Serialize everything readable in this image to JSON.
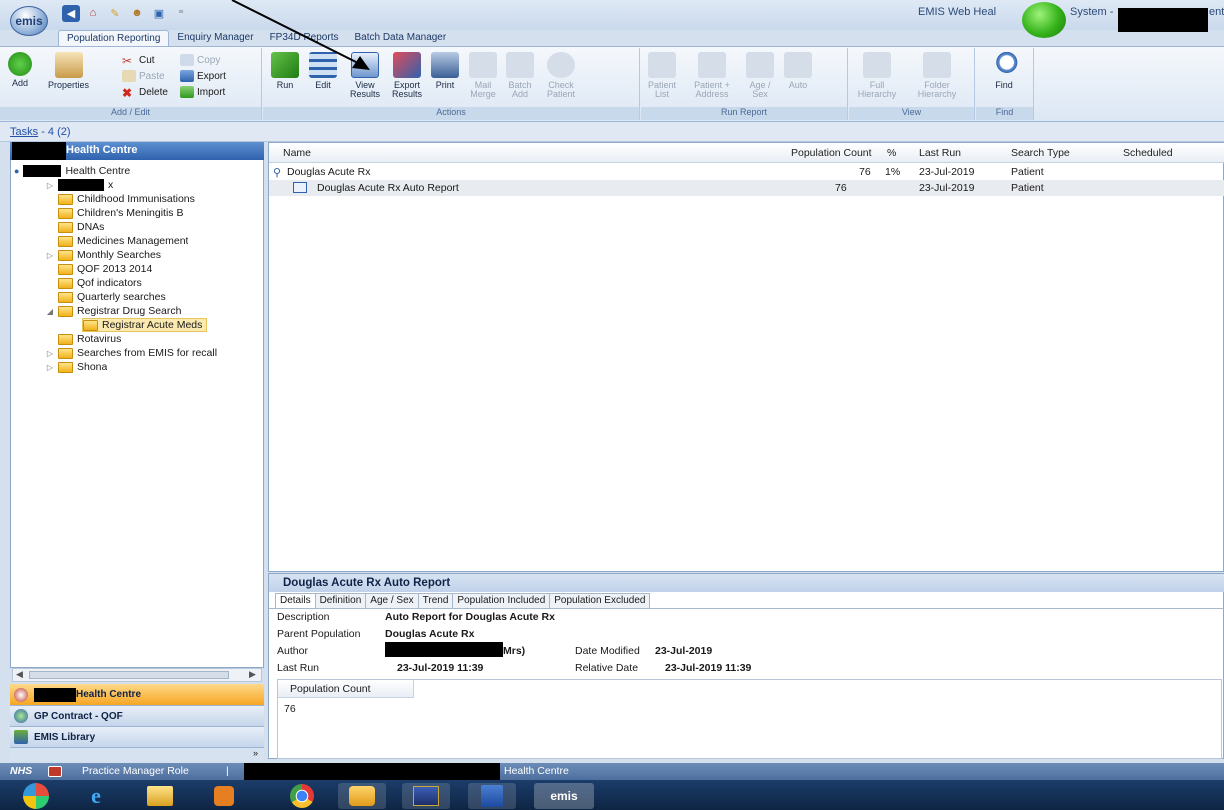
{
  "app": {
    "logo": "emis",
    "title_prefix": "EMIS Web Heal",
    "title_mid": "System -",
    "title_suffix": "ent"
  },
  "tabs": [
    {
      "label": "Population Reporting",
      "active": true
    },
    {
      "label": "Enquiry Manager",
      "active": false
    },
    {
      "label": "FP34D Reports",
      "active": false
    },
    {
      "label": "Batch Data Manager",
      "active": false
    }
  ],
  "ribbon": {
    "add_edit": {
      "label": "Add / Edit",
      "add": "Add",
      "properties": "Properties",
      "cut": "Cut",
      "copy": "Copy",
      "paste": "Paste",
      "export": "Export",
      "delete": "Delete",
      "import": "Import"
    },
    "actions": {
      "label": "Actions",
      "run": "Run",
      "edit": "Edit",
      "view_results": "View Results",
      "export_results": "Export Results",
      "print": "Print",
      "mail_merge": "Mail Merge",
      "batch_add": "Batch Add",
      "check_patient": "Check Patient"
    },
    "run_report": {
      "label": "Run Report",
      "patient_list": "Patient List",
      "patient_address": "Patient + Address",
      "age_sex": "Age / Sex",
      "auto": "Auto"
    },
    "view": {
      "label": "View",
      "full_hierarchy": "Full Hierarchy",
      "folder_hierarchy": "Folder Hierarchy"
    },
    "find": {
      "label": "Find",
      "find": "Find"
    }
  },
  "tasks": {
    "label": "Tasks",
    "suffix": "- 4 (2)"
  },
  "left_panel": {
    "header_suffix": "Health Centre",
    "root": "Health Centre",
    "root_child": "x",
    "items": [
      {
        "label": "Childhood Immunisations"
      },
      {
        "label": "Children's Meningitis B"
      },
      {
        "label": "DNAs"
      },
      {
        "label": "Medicines Management"
      },
      {
        "label": "Monthly Searches"
      },
      {
        "label": "QOF 2013 2014"
      },
      {
        "label": "Qof indicators"
      },
      {
        "label": "Quarterly searches"
      },
      {
        "label": "Registrar Drug Search"
      },
      {
        "label": "Registrar Acute Meds"
      },
      {
        "label": "Rotavirus"
      },
      {
        "label": "Searches from EMIS for recall"
      },
      {
        "label": "Shona"
      }
    ],
    "nav": [
      {
        "label": "Health Centre"
      },
      {
        "label": "GP Contract - QOF"
      },
      {
        "label": "EMIS Library"
      }
    ]
  },
  "grid": {
    "columns": [
      "Name",
      "Population Count",
      "%",
      "Last Run",
      "Search Type",
      "Scheduled"
    ],
    "rows": [
      {
        "name": "Douglas Acute Rx",
        "count": "76",
        "pct": "1%",
        "last_run": "23-Jul-2019",
        "type": "Patient",
        "scheduled": ""
      },
      {
        "name": "Douglas Acute Rx Auto Report",
        "count": "76",
        "pct": "",
        "last_run": "23-Jul-2019",
        "type": "Patient",
        "scheduled": ""
      }
    ]
  },
  "details": {
    "title": "Douglas Acute Rx Auto Report",
    "tabs": [
      "Details",
      "Definition",
      "Age / Sex",
      "Trend",
      "Population Included",
      "Population Excluded"
    ],
    "description_label": "Description",
    "description": "Auto Report for Douglas Acute Rx",
    "parent_label": "Parent Population",
    "parent": "Douglas Acute Rx",
    "author_label": "Author",
    "author_suffix": "Mrs)",
    "date_modified_label": "Date Modified",
    "date_modified": "23-Jul-2019",
    "last_run_label": "Last Run",
    "last_run": "23-Jul-2019 11:39",
    "relative_date_label": "Relative Date",
    "relative_date": "23-Jul-2019 11:39",
    "pc_header": "Population Count",
    "pc_value": "76"
  },
  "status": {
    "nhs": "NHS",
    "role": "Practice Manager Role",
    "separator": "|",
    "org_suffix": "Health Centre"
  },
  "taskbar": {
    "emis": "emis"
  }
}
